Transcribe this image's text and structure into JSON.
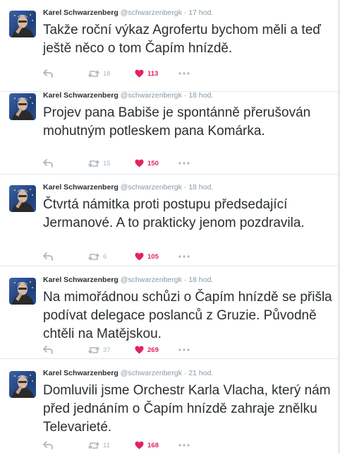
{
  "tweets": [
    {
      "fullname": "Karel Schwarzenberg",
      "username": "@schwarzenbergk",
      "separator": "·",
      "time": "17 hod.",
      "text": "Takže roční výkaz Agrofertu bychom měli a teď ještě něco o tom Čapím hnízdě.",
      "retweets": "18",
      "likes": "113"
    },
    {
      "fullname": "Karel Schwarzenberg",
      "username": "@schwarzenbergk",
      "separator": "·",
      "time": "18 hod.",
      "text": "Projev pana Babiše je spontánně přerušován mohutným potleskem pana Komárka.",
      "retweets": "15",
      "likes": "150"
    },
    {
      "fullname": "Karel Schwarzenberg",
      "username": "@schwarzenbergk",
      "separator": "·",
      "time": "18 hod.",
      "text": "Čtvrtá námitka proti postupu předsedající Jermanové. A to prakticky jenom pozdravila.",
      "retweets": "6",
      "likes": "105"
    },
    {
      "fullname": "Karel Schwarzenberg",
      "username": "@schwarzenbergk",
      "separator": "·",
      "time": "18 hod.",
      "text": "Na mimořádnou schůzi o Čapím hnízdě se přišla podívat delegace poslanců z Gruzie. Původně chtěli na Matějskou.",
      "retweets": "37",
      "likes": "269"
    },
    {
      "fullname": "Karel Schwarzenberg",
      "username": "@schwarzenbergk",
      "separator": "·",
      "time": "21 hod.",
      "text": "Domluvili jsme Orchestr Karla Vlacha, který nám před jednáním o Čapím hnízdě zahraje znělku Televarieté.",
      "retweets": "11",
      "likes": "168"
    }
  ],
  "icons": {
    "reply": "reply-arrow-icon",
    "retweet": "retweet-icon",
    "like": "heart-icon",
    "more": "more-dots-icon"
  },
  "colors": {
    "like_active": "#e0245e",
    "muted": "#aab8c2",
    "text": "#292f33",
    "meta": "#8899a6",
    "border": "#e1e8ed"
  }
}
